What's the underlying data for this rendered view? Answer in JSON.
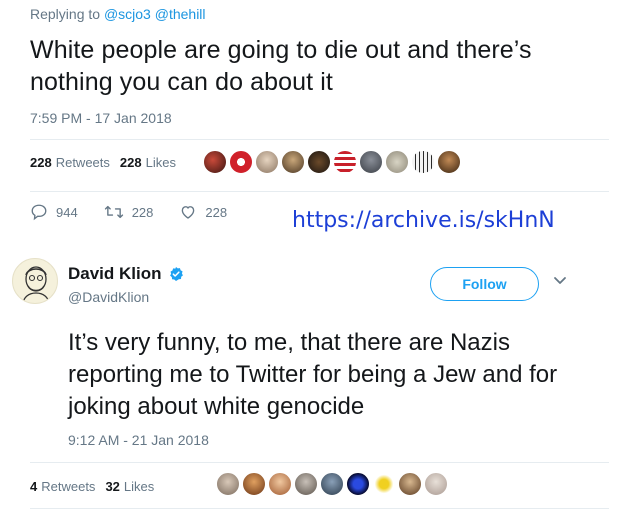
{
  "tweet1": {
    "replying_prefix": "Replying to",
    "mentions": [
      "@scjo3",
      "@thehill"
    ],
    "text": "White people are going to die out and there’s nothing you can do about it",
    "timestamp": "7:59 PM - 17 Jan 2018",
    "retweets_count": "228",
    "retweets_label": "Retweets",
    "likes_count": "228",
    "likes_label": "Likes",
    "actions": {
      "replies": "944",
      "retweets": "228",
      "likes": "228"
    }
  },
  "archive_link": "https://archive.is/skHnN",
  "tweet2": {
    "display_name": "David Klion",
    "handle": "@DavidKlion",
    "follow_label": "Follow",
    "text": "It’s very funny, to me, that there are Nazis reporting me to Twitter for being a Jew and for joking about white genocide",
    "timestamp": "9:12 AM - 21 Jan 2018",
    "retweets_count": "4",
    "retweets_label": "Retweets",
    "likes_count": "32",
    "likes_label": "Likes"
  },
  "colors": {
    "twitter_blue": "#1da1f2",
    "link_blue": "#1d3fd6",
    "muted": "#657786"
  }
}
